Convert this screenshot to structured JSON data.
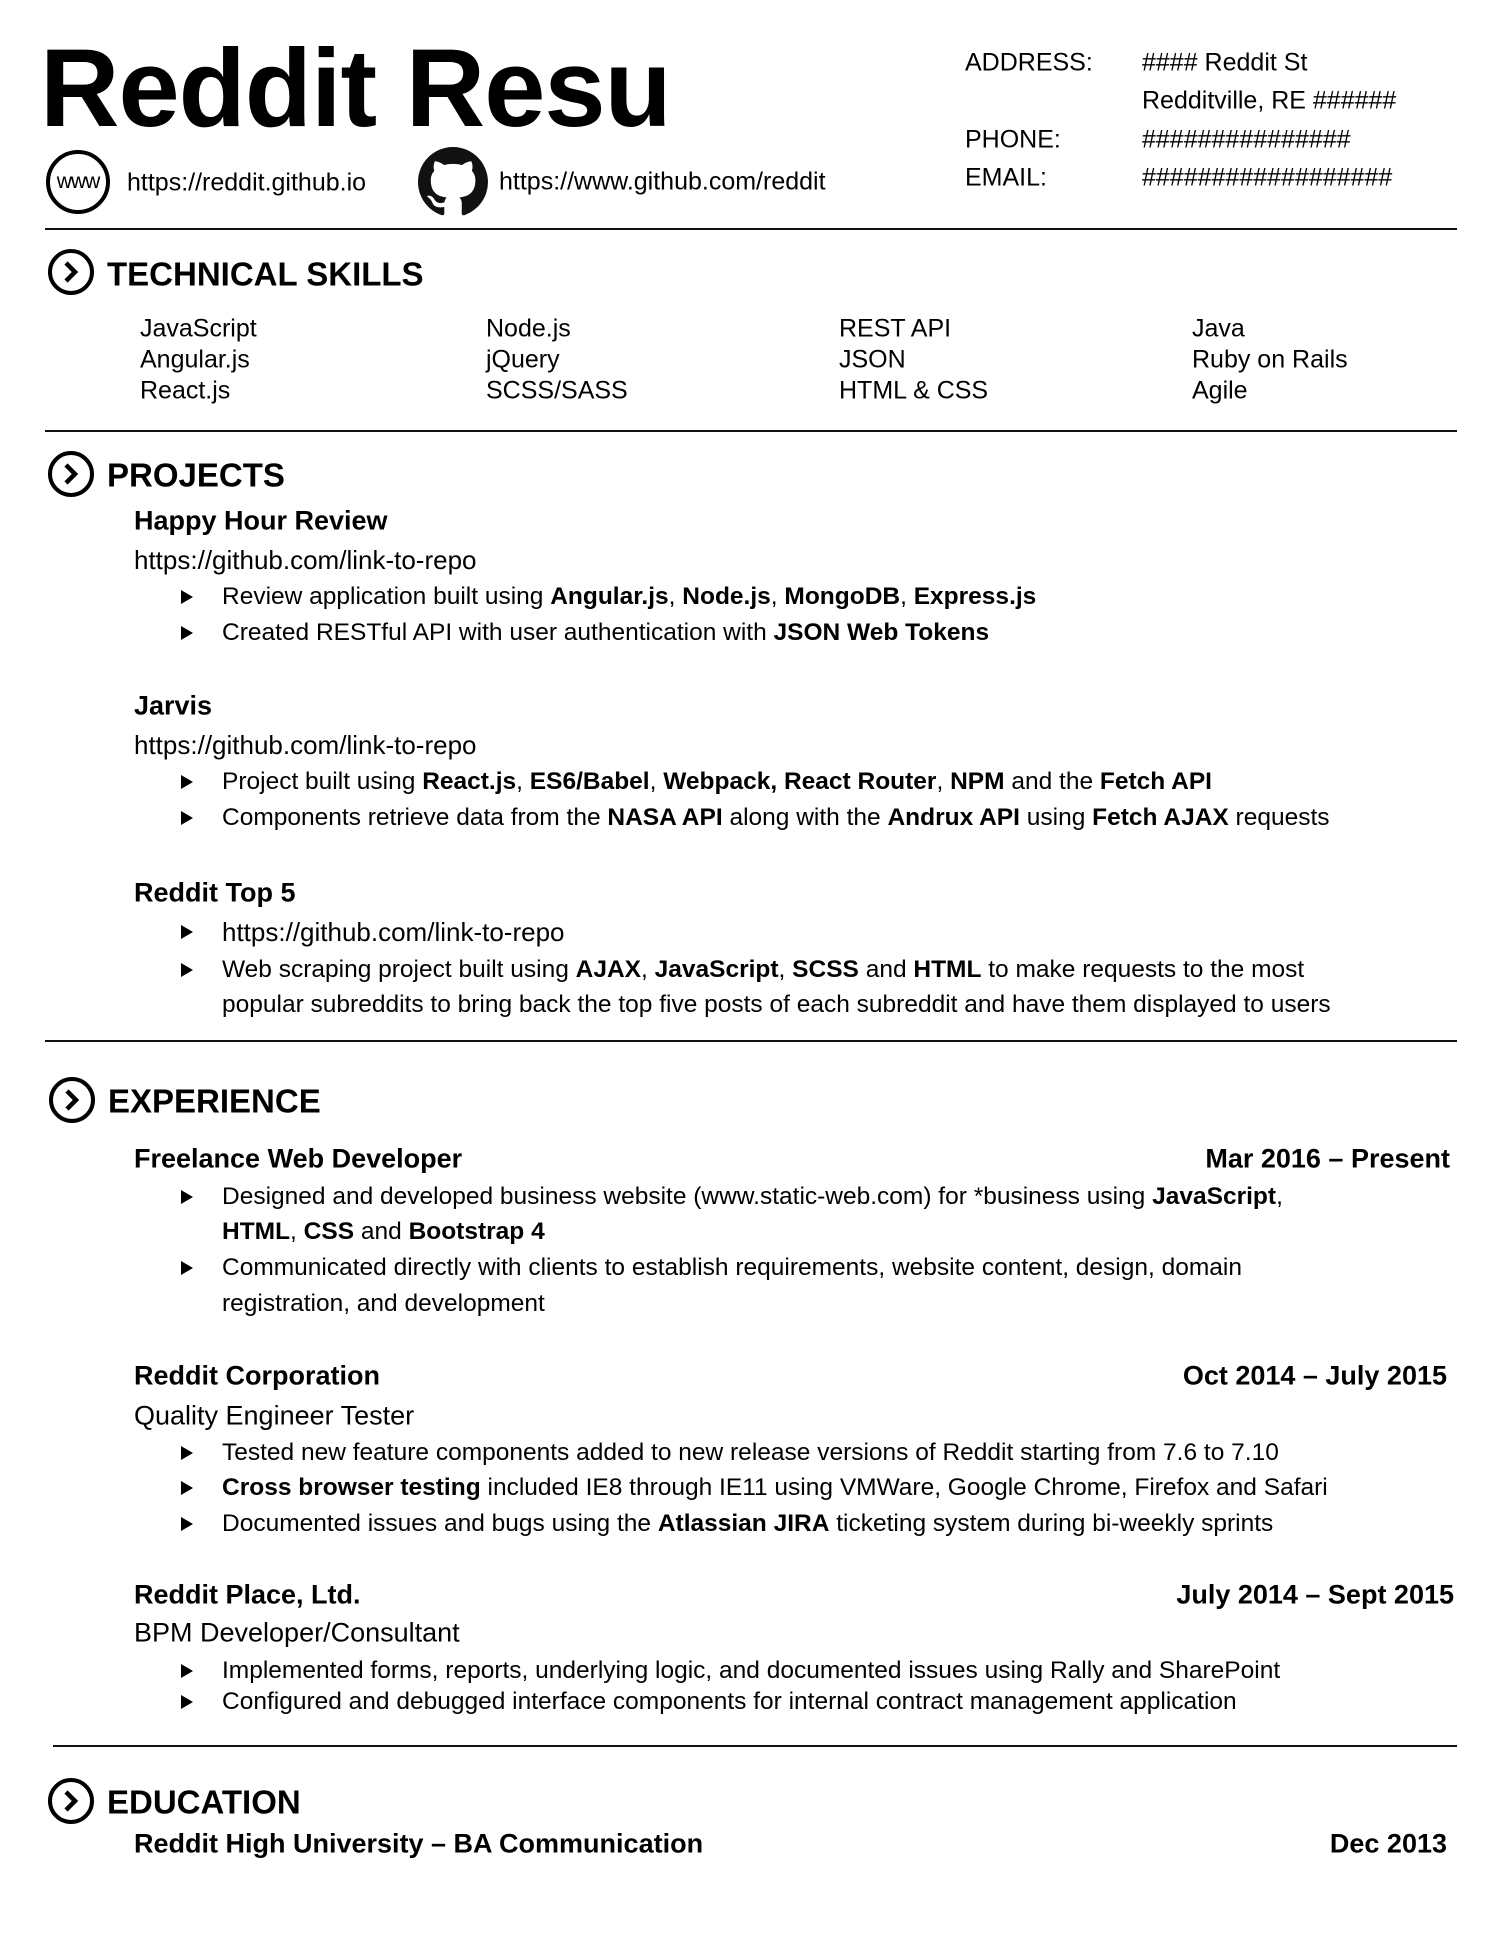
{
  "header": {
    "name": "Reddit Resu",
    "website": {
      "icon": "www-icon",
      "text": "https://reddit.github.io"
    },
    "github": {
      "icon": "github-icon",
      "text": "https://www.github.com/reddit"
    },
    "www_glyph": "www",
    "contact": {
      "address_label": "ADDRESS:",
      "address_line1": "#### Reddit St",
      "address_line2": "Redditville, RE ######",
      "phone_label": "PHONE:",
      "phone_value": "###############",
      "email_label": "EMAIL:",
      "email_value": "##################"
    }
  },
  "sections": {
    "skills": {
      "title": "TECHNICAL SKILLS",
      "icon": "chevron-circle-icon",
      "columns": [
        [
          "JavaScript",
          "Angular.js",
          "React.js"
        ],
        [
          "Node.js",
          "jQuery",
          "SCSS/SASS"
        ],
        [
          "REST API",
          "JSON",
          "HTML & CSS"
        ],
        [
          "Java",
          "Ruby on Rails",
          "Agile"
        ]
      ]
    },
    "projects": {
      "title": "PROJECTS",
      "icon": "chevron-circle-icon",
      "items": [
        {
          "name": "Happy Hour Review",
          "url": "https://github.com/link-to-repo",
          "bullets": [
            [
              [
                "Review application built using ",
                false
              ],
              [
                "Angular.js",
                true
              ],
              [
                ", ",
                false
              ],
              [
                "Node.js",
                true
              ],
              [
                ", ",
                false
              ],
              [
                "MongoDB",
                true
              ],
              [
                ", ",
                false
              ],
              [
                "Express.js",
                true
              ]
            ],
            [
              [
                "Created RESTful API with user authentication with ",
                false
              ],
              [
                "JSON Web Tokens",
                true
              ]
            ]
          ]
        },
        {
          "name": "Jarvis",
          "url": "https://github.com/link-to-repo",
          "bullets": [
            [
              [
                "Project built using ",
                false
              ],
              [
                "React.js",
                true
              ],
              [
                ", ",
                false
              ],
              [
                "ES6/Babel",
                true
              ],
              [
                ", ",
                false
              ],
              [
                "Webpack, React Router",
                true
              ],
              [
                ", ",
                false
              ],
              [
                "NPM",
                true
              ],
              [
                " and the ",
                false
              ],
              [
                "Fetch API",
                true
              ]
            ],
            [
              [
                "Components retrieve data from the ",
                false
              ],
              [
                "NASA API",
                true
              ],
              [
                " along with the ",
                false
              ],
              [
                "Andrux API",
                true
              ],
              [
                " using ",
                false
              ],
              [
                "Fetch AJAX",
                true
              ],
              [
                " requests",
                false
              ]
            ]
          ]
        },
        {
          "name": "Reddit Top 5",
          "bullets": [
            [
              [
                "https://github.com/link-to-repo",
                false
              ]
            ],
            [
              [
                "Web scraping project built using ",
                false
              ],
              [
                "AJAX",
                true
              ],
              [
                ", ",
                false
              ],
              [
                "JavaScript",
                true
              ],
              [
                ", ",
                false
              ],
              [
                "SCSS",
                true
              ],
              [
                " and ",
                false
              ],
              [
                "HTML",
                true
              ],
              [
                " to make requests to the most",
                false
              ]
            ]
          ],
          "continuation": "popular subreddits to bring back the top five posts of each subreddit and have them displayed to users"
        }
      ]
    },
    "experience": {
      "title": "EXPERIENCE",
      "icon": "chevron-circle-icon",
      "jobs": [
        {
          "company": "Freelance Web Developer",
          "dates": "Mar 2016 – Present",
          "bullets": [
            [
              [
                "Designed and developed business website (www.static-web.com) for *business using ",
                false
              ],
              [
                "JavaScript",
                true
              ],
              [
                ",",
                false
              ]
            ],
            [
              [
                "Communicated directly with clients to establish requirements, website content, design, domain",
                false
              ]
            ]
          ],
          "continuations": [
            [
              [
                "HTML",
                true
              ],
              [
                ", ",
                false
              ],
              [
                "CSS",
                true
              ],
              [
                " and ",
                false
              ],
              [
                "Bootstrap 4",
                true
              ]
            ],
            [
              [
                "registration, and development",
                false
              ]
            ]
          ]
        },
        {
          "company": "Reddit Corporation",
          "dates": "Oct 2014 – July 2015",
          "role": "Quality Engineer Tester",
          "bullets": [
            [
              [
                "Tested new feature components added to new release versions of Reddit starting from 7.6 to 7.10",
                false
              ]
            ],
            [
              [
                "Cross browser testing",
                true
              ],
              [
                " included IE8 through IE11 using VMWare, Google Chrome, Firefox and Safari",
                false
              ]
            ],
            [
              [
                "Documented issues and bugs using the ",
                false
              ],
              [
                "Atlassian JIRA",
                true
              ],
              [
                " ticketing system during bi-weekly sprints",
                false
              ]
            ]
          ]
        },
        {
          "company": "Reddit Place, Ltd.",
          "dates": "July 2014 – Sept 2015",
          "role": "BPM Developer/Consultant",
          "bullets": [
            [
              [
                "Implemented forms, reports, underlying logic, and documented issues using Rally and SharePoint",
                false
              ]
            ],
            [
              [
                "Configured and debugged interface components for internal contract management application",
                false
              ]
            ]
          ]
        }
      ]
    },
    "education": {
      "title": "EDUCATION",
      "icon": "chevron-circle-icon",
      "school": "Reddit High University – BA Communication",
      "date": "Dec 2013"
    }
  }
}
